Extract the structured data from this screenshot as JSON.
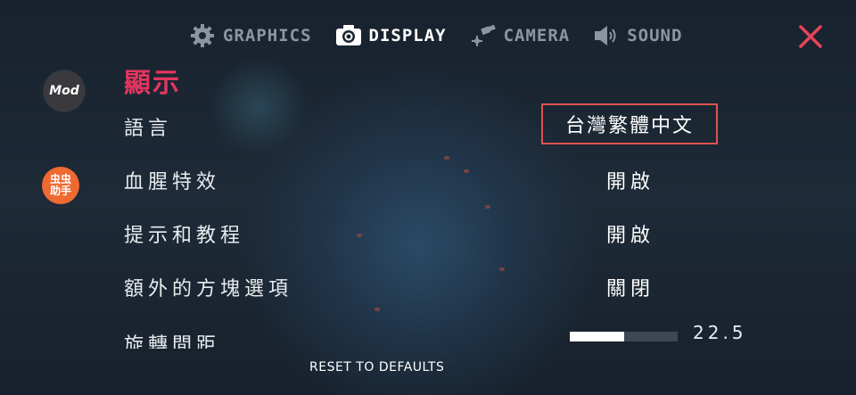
{
  "tabs": [
    {
      "label": "GRAPHICS",
      "icon": "gear-icon"
    },
    {
      "label": "DISPLAY",
      "icon": "camera-icon"
    },
    {
      "label": "CAMERA",
      "icon": "satellite-icon"
    },
    {
      "label": "SOUND",
      "icon": "speaker-icon"
    }
  ],
  "active_tab": "DISPLAY",
  "badges": {
    "mod": "Mod",
    "helper_line1": "虫虫",
    "helper_line2": "助手"
  },
  "section": {
    "title": "顯示"
  },
  "settings": [
    {
      "label": "語言",
      "value": "台灣繁體中文"
    },
    {
      "label": "血腥特效",
      "value": "開啟"
    },
    {
      "label": "提示和教程",
      "value": "開啟"
    },
    {
      "label": "額外的方塊選項",
      "value": "關閉"
    },
    {
      "label": "旋轉間距",
      "value": "22.5",
      "fill_fraction": 0.5
    }
  ],
  "reset_label": "RESET TO DEFAULTS",
  "colors": {
    "accent": "#e4355e",
    "close": "#e8445a",
    "selection_border": "#e0514f",
    "background": "#1b2633"
  }
}
